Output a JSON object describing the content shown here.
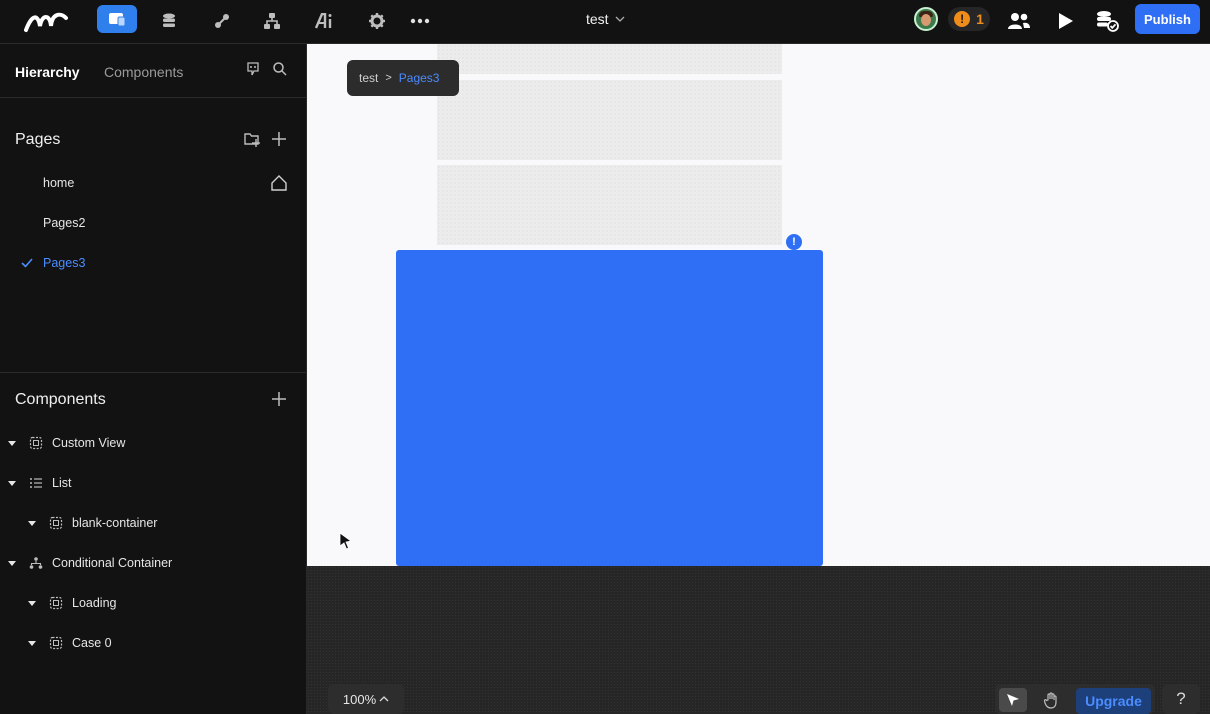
{
  "topbar": {
    "logo": "logo-icon",
    "nav_icons": [
      "pages-icon",
      "database-icon",
      "integrations-icon",
      "workflow-icon",
      "ai-icon",
      "gear-icon",
      "more-icon"
    ],
    "project_title": "test",
    "warning_count": "1",
    "publish_label": "Publish",
    "accent": "#2f6ff5"
  },
  "sidebar": {
    "tabs": [
      {
        "label": "Hierarchy",
        "active": true
      },
      {
        "label": "Components",
        "active": false
      }
    ],
    "pages_title": "Pages",
    "pages": [
      {
        "label": "home",
        "home": true
      },
      {
        "label": "Pages2"
      },
      {
        "label": "Pages3",
        "selected": true
      }
    ],
    "components_title": "Components",
    "components": [
      {
        "label": "Custom View",
        "icon": "custom-view-icon",
        "level": 0
      },
      {
        "label": "List",
        "icon": "list-icon",
        "level": 0
      },
      {
        "label": "blank-container",
        "icon": "container-icon",
        "level": 1
      },
      {
        "label": "Conditional Container",
        "icon": "conditional-icon",
        "level": 0
      },
      {
        "label": "Loading",
        "icon": "container-icon",
        "level": 1
      },
      {
        "label": "Case 0",
        "icon": "container-icon",
        "level": 1
      }
    ]
  },
  "canvas": {
    "breadcrumb": {
      "root": "test",
      "separator": ">",
      "current": "Pages3"
    },
    "selection_color": "#2f6ff5",
    "info_badge": "!"
  },
  "footer": {
    "zoom": "100%",
    "upgrade_label": "Upgrade",
    "help_label": "?"
  }
}
